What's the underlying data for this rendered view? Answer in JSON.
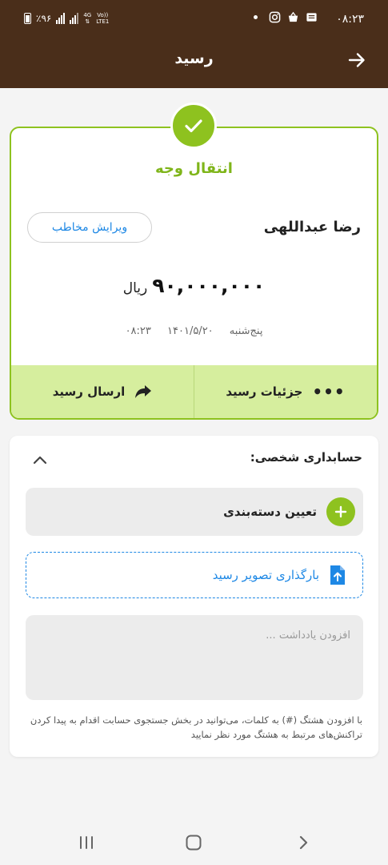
{
  "status_bar": {
    "time": "۰۸:۲۳",
    "battery": "٪۹۶",
    "network": [
      "4G",
      "Vo))",
      "LTE1"
    ]
  },
  "app_bar": {
    "title": "رسید",
    "back_icon": "arrow-forward-icon"
  },
  "receipt": {
    "title": "انتقال وجه",
    "contact_name": "رضا عبداللهی",
    "edit_contact_label": "ویرایش مخاطب",
    "amount": "۹۰,۰۰۰,۰۰۰",
    "currency": "ریال",
    "weekday": "پنج‌شنبه",
    "date": "۱۴۰۱/۵/۲۰",
    "time": "۰۸:۲۳",
    "actions": {
      "details_label": "جزئیات رسید",
      "send_label": "ارسال رسید"
    },
    "accent_color": "#8ec21f"
  },
  "accounting": {
    "title": "حسابداری شخصی:",
    "category_label": "تعیین دسته‌بندی",
    "upload_label": "بارگذاری تصویر رسید",
    "note_placeholder": "افزودن یادداشت ...",
    "note_value": "",
    "hint": "با افزودن هشتگ (#) به کلمات، می‌توانید در بخش جستجوی حسابت اقدام به پیدا کردن تراکنش‌های مرتبط به هشتگ مورد نظر نمایید"
  },
  "colors": {
    "header": "#4a2e1a",
    "accent_green": "#8ec21f",
    "link_blue": "#1e88e5"
  }
}
